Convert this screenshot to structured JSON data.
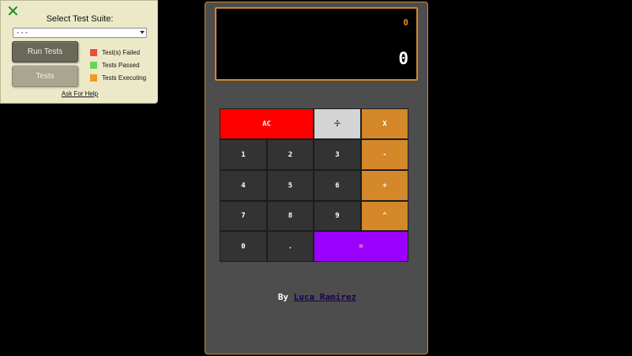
{
  "test_panel": {
    "close_icon": "close-icon",
    "title": "Select Test Suite:",
    "select_value": "- - -",
    "run_button": "Run Tests",
    "tests_button": "Tests",
    "legend": [
      {
        "label": "Test(s) Failed",
        "color": "#e8503a"
      },
      {
        "label": "Tests Passed",
        "color": "#6ad35a"
      },
      {
        "label": "Tests Executing",
        "color": "#f19a22"
      }
    ],
    "help_link": "Ask For Help"
  },
  "calculator": {
    "formula": "0",
    "output": "0",
    "keys": {
      "clear": "AC",
      "divide": "÷",
      "multiply": "X",
      "one": "1",
      "two": "2",
      "three": "3",
      "subtract": "-",
      "four": "4",
      "five": "5",
      "six": "6",
      "add": "+",
      "seven": "7",
      "eight": "8",
      "nine": "9",
      "power": "^",
      "zero": "0",
      "decimal": ".",
      "equals": "="
    },
    "credit_prefix": "By",
    "author": "Luca Ramirez"
  },
  "colors": {
    "accent": "#d4882a",
    "clear": "#ff0000",
    "equals": "#9a00ff",
    "number_key": "#333333",
    "body": "#4d4d4d"
  }
}
